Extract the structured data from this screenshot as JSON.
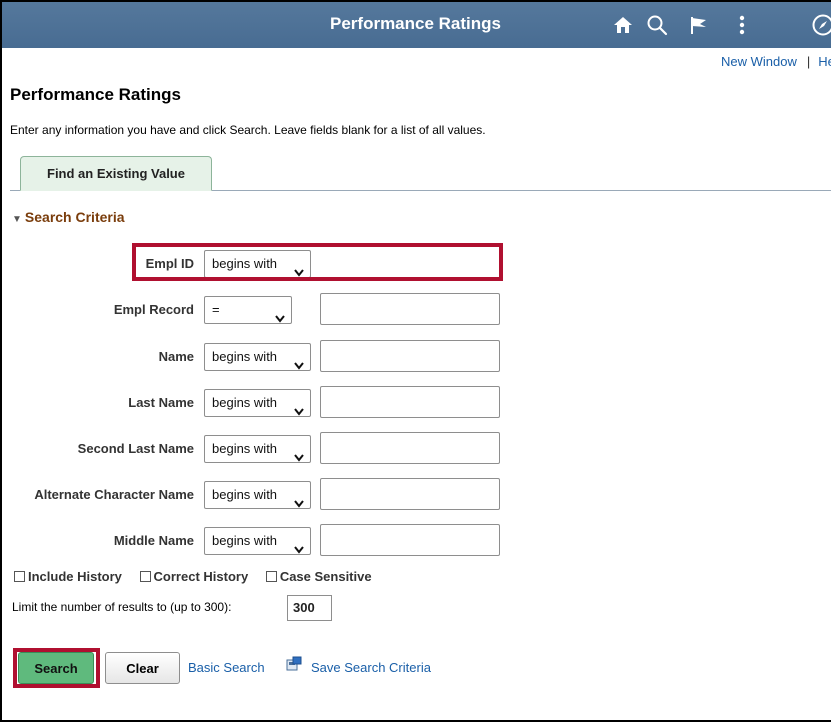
{
  "banner": {
    "title": "Performance Ratings",
    "color": "#4f739a"
  },
  "top_links": {
    "new_window": "New Window",
    "separator": "|",
    "help": "Help"
  },
  "page": {
    "title": "Performance Ratings",
    "instructions": "Enter any information you have and click Search. Leave fields blank for a list of all values."
  },
  "tab": {
    "label": "Find an Existing Value"
  },
  "search_criteria": {
    "heading": "Search Criteria",
    "fields": [
      {
        "label": "Empl ID",
        "operator": "begins with",
        "value": ""
      },
      {
        "label": "Empl Record",
        "operator": "=",
        "value": ""
      },
      {
        "label": "Name",
        "operator": "begins with",
        "value": ""
      },
      {
        "label": "Last Name",
        "operator": "begins with",
        "value": ""
      },
      {
        "label": "Second Last Name",
        "operator": "begins with",
        "value": ""
      },
      {
        "label": "Alternate Character Name",
        "operator": "begins with",
        "value": ""
      },
      {
        "label": "Middle Name",
        "operator": "begins with",
        "value": ""
      }
    ]
  },
  "options": {
    "include_history": "Include History",
    "correct_history": "Correct History",
    "case_sensitive": "Case Sensitive"
  },
  "limit": {
    "label": "Limit the number of results to (up to 300):",
    "value": "300"
  },
  "actions": {
    "search": "Search",
    "clear": "Clear",
    "basic_search": "Basic Search",
    "save_search_criteria": "Save Search Criteria"
  },
  "icons": [
    "home-icon",
    "search-icon",
    "flag-icon",
    "more-vertical-icon",
    "navbar-compass-icon",
    "chevron-down-icon",
    "save-criteria-icon"
  ],
  "colors": {
    "highlight": "#b01030",
    "search_button": "#5fba7d",
    "section_heading": "#7a3d0c",
    "link": "#1a5fa8"
  }
}
